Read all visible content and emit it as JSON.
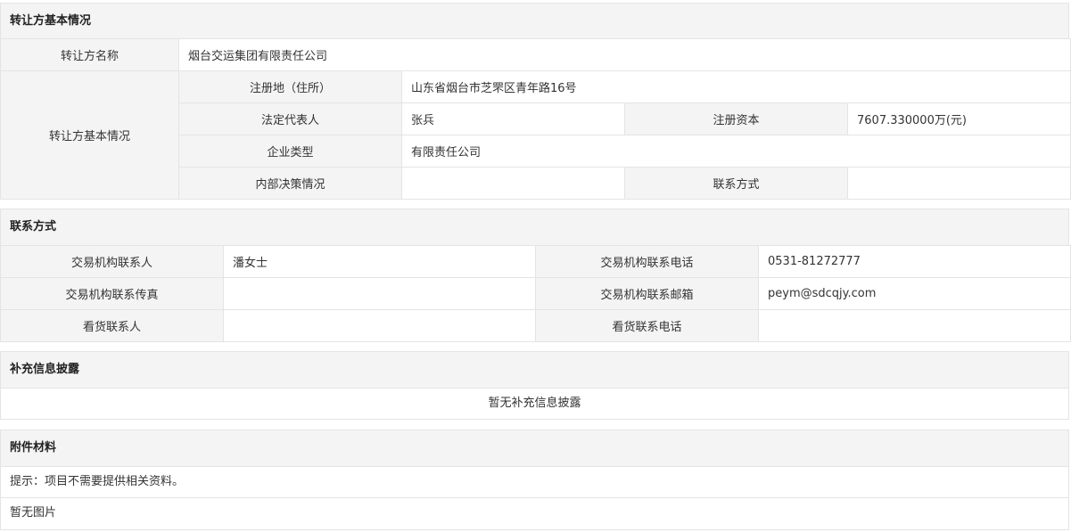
{
  "transferor": {
    "title": "转让方基本情况",
    "name_label": "转让方名称",
    "name_value": "烟台交运集团有限责任公司",
    "basic_label": "转让方基本情况",
    "reg_addr_label": "注册地（住所）",
    "reg_addr_value": "山东省烟台市芝罘区青年路16号",
    "legal_rep_label": "法定代表人",
    "legal_rep_value": "张兵",
    "reg_capital_label": "注册资本",
    "reg_capital_value": "7607.330000万(元)",
    "company_type_label": "企业类型",
    "company_type_value": "有限责任公司",
    "decision_label": "内部决策情况",
    "decision_value": "",
    "contact_method_label": "联系方式",
    "contact_method_value": ""
  },
  "contact": {
    "title": "联系方式",
    "agency_contact_label": "交易机构联系人",
    "agency_contact_value": "潘女士",
    "agency_phone_label": "交易机构联系电话",
    "agency_phone_value": "0531-81272777",
    "agency_fax_label": "交易机构联系传真",
    "agency_fax_value": "",
    "agency_email_label": "交易机构联系邮箱",
    "agency_email_value": "peym@sdcqjy.com",
    "viewing_contact_label": "看货联系人",
    "viewing_contact_value": "",
    "viewing_phone_label": "看货联系电话",
    "viewing_phone_value": ""
  },
  "supplement": {
    "title": "补充信息披露",
    "empty_text": "暂无补充信息披露"
  },
  "attachments": {
    "title": "附件材料",
    "hint": "提示：项目不需要提供相关资料。",
    "no_images": "暂无图片"
  }
}
